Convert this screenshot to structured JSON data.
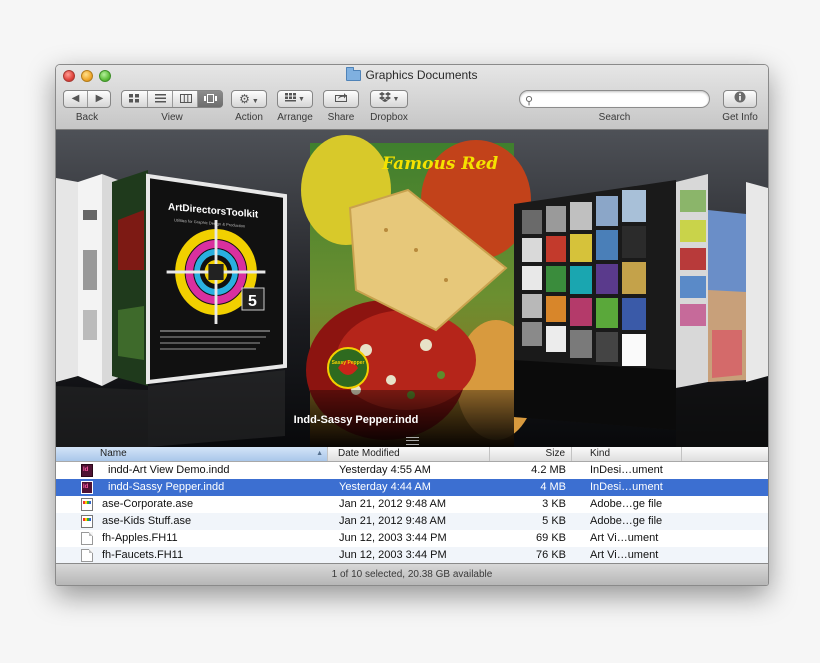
{
  "window": {
    "title": "Graphics Documents"
  },
  "toolbar": {
    "back_label": "Back",
    "view_label": "View",
    "action_label": "Action",
    "arrange_label": "Arrange",
    "share_label": "Share",
    "dropbox_label": "Dropbox",
    "search_label": "Search",
    "search_placeholder": "",
    "getinfo_label": "Get Info",
    "back_icon": "chevron-left-icon",
    "forward_icon": "chevron-right-icon",
    "view_modes": [
      "icon-view-icon",
      "list-view-icon",
      "column-view-icon",
      "coverflow-view-icon"
    ],
    "active_view": "coverflow-view-icon"
  },
  "coverflow": {
    "caption": "Indd-Sassy Pepper.indd",
    "center_cover_title": "Famous Red",
    "center_cover_badge": "Sassy Pepper",
    "left_cover_title": "ArtDirectorsToolkit",
    "left_cover_subtitle": "Utilities for Graphic Design & Production",
    "left_cover_badge": "5"
  },
  "list": {
    "columns": {
      "name": "Name",
      "date_modified": "Date Modified",
      "size": "Size",
      "kind": "Kind"
    },
    "sorted_column": "name",
    "rows": [
      {
        "name": "indd-Art View Demo.indd",
        "date": "Yesterday 4:55 AM",
        "size": "4.2 MB",
        "kind": "InDesi…ument",
        "icon": "indesign-file-icon",
        "selected": false
      },
      {
        "name": "indd-Sassy Pepper.indd",
        "date": "Yesterday 4:44 AM",
        "size": "4 MB",
        "kind": "InDesi…ument",
        "icon": "indesign-file-icon",
        "selected": true
      },
      {
        "name": "ase-Corporate.ase",
        "date": "Jan 21, 2012 9:48 AM",
        "size": "3 KB",
        "kind": "Adobe…ge file",
        "icon": "swatch-file-icon",
        "selected": false
      },
      {
        "name": "ase-Kids Stuff.ase",
        "date": "Jan 21, 2012 9:48 AM",
        "size": "5 KB",
        "kind": "Adobe…ge file",
        "icon": "swatch-file-icon",
        "selected": false
      },
      {
        "name": "fh-Apples.FH11",
        "date": "Jun 12, 2003 3:44 PM",
        "size": "69 KB",
        "kind": "Art Vi…ument",
        "icon": "document-file-icon",
        "selected": false
      },
      {
        "name": "fh-Faucets.FH11",
        "date": "Jun 12, 2003 3:44 PM",
        "size": "76 KB",
        "kind": "Art Vi…ument",
        "icon": "document-file-icon",
        "selected": false
      }
    ]
  },
  "status": {
    "text": "1 of 10 selected, 20.38 GB available"
  },
  "colors": {
    "selection": "#3c6fd1",
    "row_alt": "#f1f5fa",
    "coverflow_bg": "#1b1c20"
  }
}
